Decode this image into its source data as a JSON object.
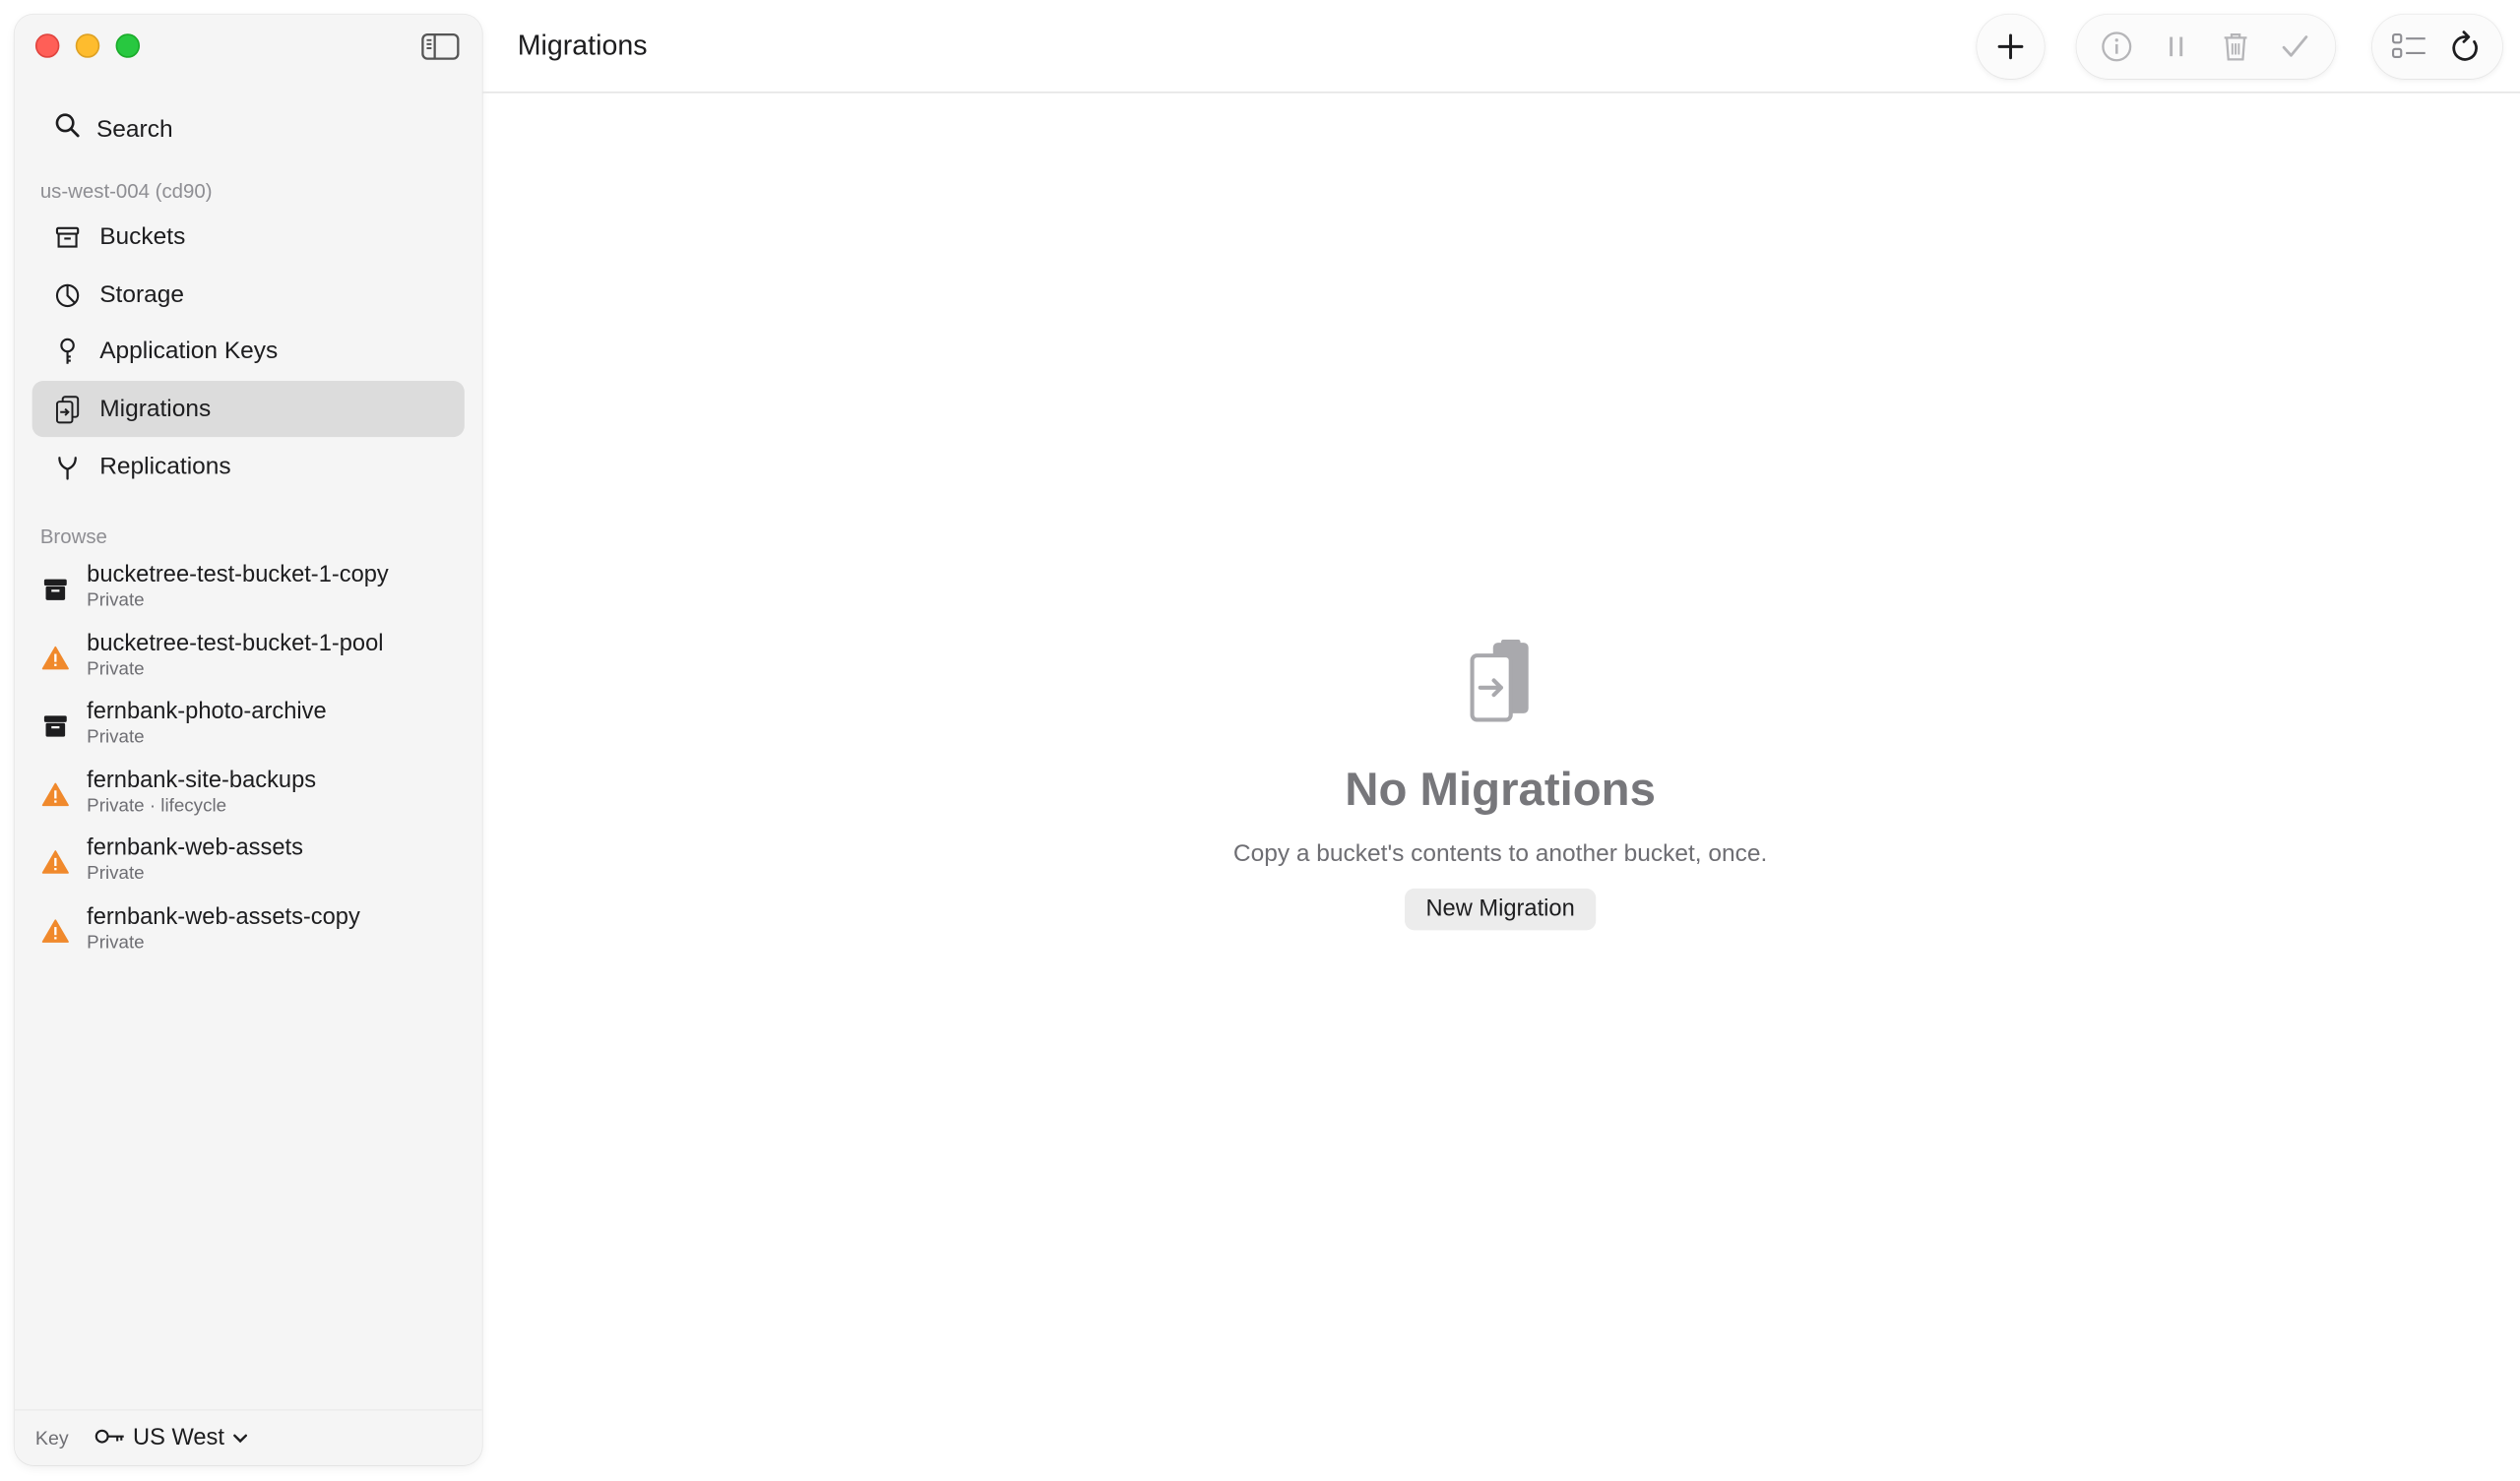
{
  "sidebar": {
    "search_label": "Search",
    "account_label": "us-west-004 (cd90)",
    "nav": [
      {
        "label": "Buckets",
        "icon": "archive-box-icon"
      },
      {
        "label": "Storage",
        "icon": "pie-chart-icon"
      },
      {
        "label": "Application Keys",
        "icon": "key-icon"
      },
      {
        "label": "Migrations",
        "icon": "migration-icon",
        "active": true
      },
      {
        "label": "Replications",
        "icon": "fork-icon"
      }
    ],
    "browse_label": "Browse",
    "buckets": [
      {
        "name": "bucketree-test-bucket-1-copy",
        "sub": "Private",
        "icon": "archive-icon"
      },
      {
        "name": "bucketree-test-bucket-1-pool",
        "sub": "Private",
        "icon": "warning-icon"
      },
      {
        "name": "fernbank-photo-archive",
        "sub": "Private",
        "icon": "archive-icon"
      },
      {
        "name": "fernbank-site-backups",
        "sub": "Private · lifecycle",
        "icon": "warning-icon"
      },
      {
        "name": "fernbank-web-assets",
        "sub": "Private",
        "icon": "warning-icon"
      },
      {
        "name": "fernbank-web-assets-copy",
        "sub": "Private",
        "icon": "warning-icon"
      }
    ],
    "footer": {
      "key_label": "Key",
      "region": "US West"
    }
  },
  "main": {
    "title": "Migrations",
    "empty": {
      "title": "No Migrations",
      "description": "Copy a bucket's contents to another bucket, once.",
      "button": "New Migration"
    }
  },
  "colors": {
    "accent_warning": "#f0892c",
    "selection": "#dcdcdc"
  }
}
